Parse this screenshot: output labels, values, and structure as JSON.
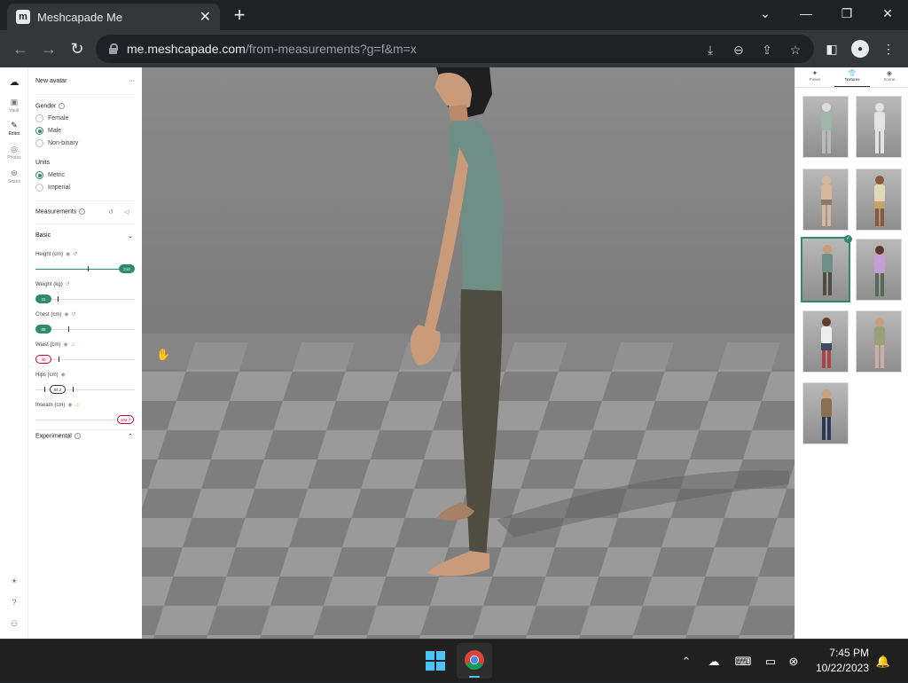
{
  "browser": {
    "tab_title": "Meshcapade Me",
    "tab_favicon": "m",
    "url_domain": "me.meshcapade.com",
    "url_path": "/from-measurements?g=f&m=x"
  },
  "icons": {
    "back": "←",
    "forward": "→",
    "reload": "↻",
    "new_tab": "+",
    "close": "✕",
    "minimize": "—",
    "maximize": "❐",
    "window_close": "✕",
    "chevron_down": "⌄",
    "install": "⤓",
    "zoom": "⊖",
    "share": "⇪",
    "star": "☆",
    "sidebar": "◧",
    "profile": "●",
    "menu": "⋮",
    "more": "···",
    "collapse": "⌄",
    "expand": "⌃",
    "undo": "↺",
    "speaker": "◁",
    "eye": "◉",
    "hand": "✋",
    "check": "✓"
  },
  "app": {
    "rail": [
      {
        "icon": "▣",
        "label": "Vault"
      },
      {
        "icon": "✎",
        "label": "Editor"
      },
      {
        "icon": "◎",
        "label": "Photos"
      },
      {
        "icon": "⊛",
        "label": "Scans"
      }
    ],
    "rail_bottom": [
      "☀",
      "?",
      "⚇"
    ],
    "panel": {
      "title": "New avatar",
      "gender_label": "Gender",
      "gender_options": [
        "Female",
        "Male",
        "Non-binary"
      ],
      "gender_selected": "Male",
      "units_label": "Units",
      "units_options": [
        "Metric",
        "Imperial"
      ],
      "units_selected": "Metric",
      "measurements_label": "Measurements",
      "basic_label": "Basic",
      "measurements": [
        {
          "label": "Height (cm)",
          "value": "210"
        },
        {
          "label": "Weight (kg)",
          "value": "41"
        },
        {
          "label": "Chest (cm)",
          "value": "88"
        },
        {
          "label": "Waist (cm)",
          "value": "40"
        },
        {
          "label": "Hips (cm)",
          "value": "84.2"
        },
        {
          "label": "Inseam (cm)",
          "value": "102.7"
        }
      ],
      "experimental_label": "Experimental"
    },
    "right_tabs": [
      {
        "icon": "✦",
        "label": "Poses"
      },
      {
        "icon": "👕",
        "label": "Textures"
      },
      {
        "icon": "◈",
        "label": "Scene"
      }
    ],
    "thumbnails_count": 9,
    "selected_thumbnail": 5
  },
  "taskbar": {
    "time": "7:45 PM",
    "date": "10/22/2023"
  }
}
